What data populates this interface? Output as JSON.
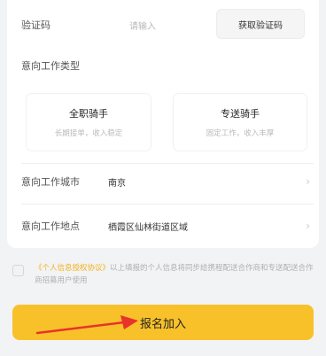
{
  "form": {
    "code_label": "验证码",
    "code_placeholder": "请输入",
    "get_code_button": "获取验证码",
    "job_type_label": "意向工作类型",
    "job_types": [
      {
        "title": "全职骑手",
        "subtitle": "长期接单，收入稳定"
      },
      {
        "title": "专送骑手",
        "subtitle": "固定工作，收入丰厚"
      }
    ],
    "city_label": "意向工作城市",
    "city_value": "南京",
    "location_label": "意向工作地点",
    "location_value": "栖霞区仙林街道区域"
  },
  "agreement": {
    "link_text": "《个人信息授权协议》",
    "text": "以上填报的个人信息将同步给携程配送合作商和专送配送合作商招募用户使用"
  },
  "submit_button": "报名加入",
  "colors": {
    "accent": "#f8c12a",
    "link": "#f3b118",
    "arrow": "#e8332a"
  }
}
